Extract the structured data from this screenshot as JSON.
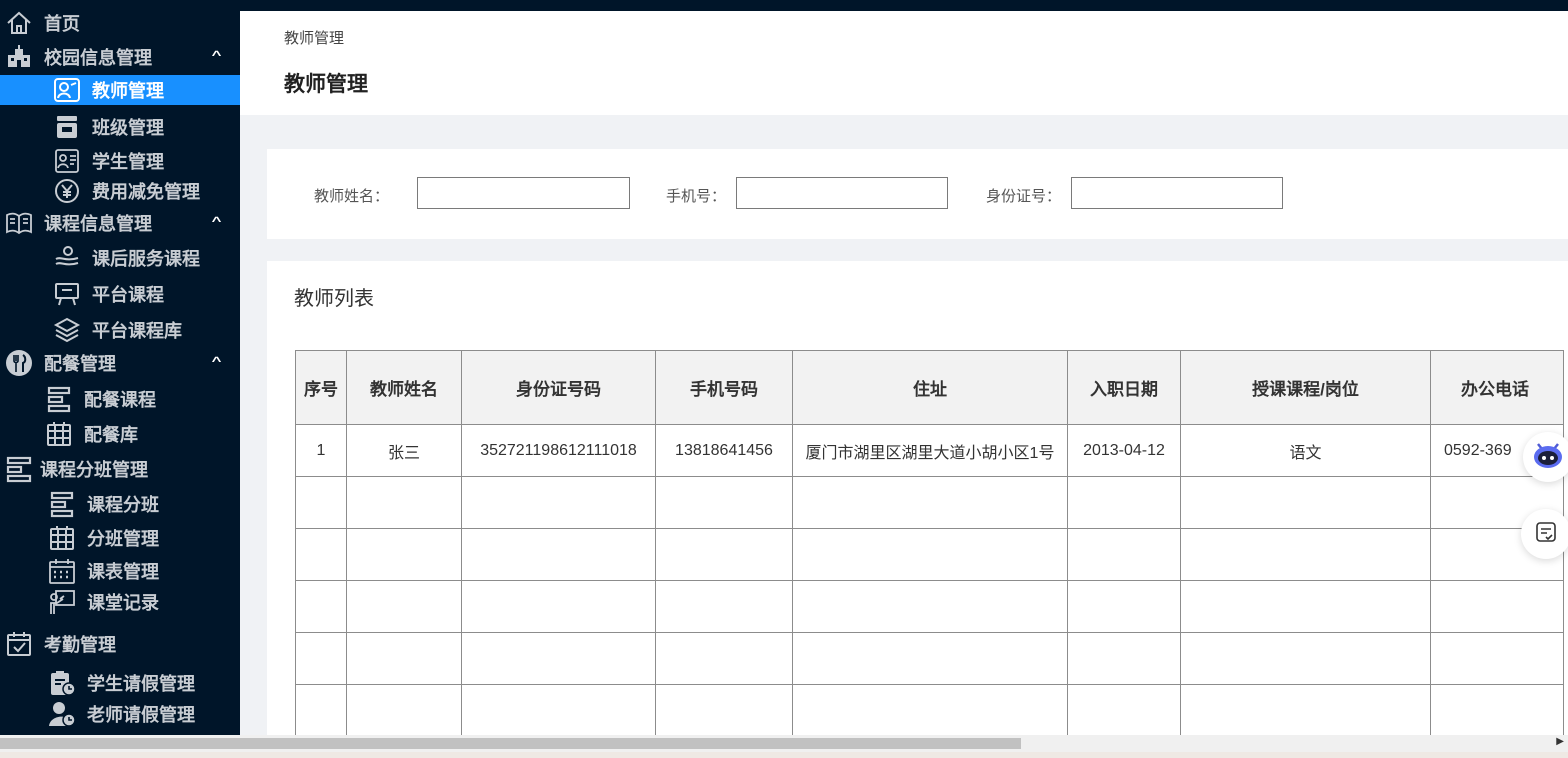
{
  "colors": {
    "sidebar_bg": "#001529",
    "active_bg": "#1890ff",
    "content_bg": "#f0f2f5"
  },
  "sidebar": {
    "home": {
      "label": "首页",
      "icon": "home-icon"
    },
    "groups": [
      {
        "label": "校园信息管理",
        "icon": "school-icon",
        "children": [
          {
            "label": "教师管理",
            "icon": "teacher-icon",
            "active": true
          },
          {
            "label": "班级管理",
            "icon": "class-icon"
          },
          {
            "label": "学生管理",
            "icon": "student-card-icon"
          },
          {
            "label": "费用减免管理",
            "icon": "yuan-icon"
          }
        ]
      },
      {
        "label": "课程信息管理",
        "icon": "book-icon",
        "children": [
          {
            "label": "课后服务课程",
            "icon": "service-icon"
          },
          {
            "label": "平台课程",
            "icon": "board-icon"
          },
          {
            "label": "平台课程库",
            "icon": "layers-icon"
          }
        ]
      },
      {
        "label": "配餐管理",
        "icon": "dining-icon",
        "children": [
          {
            "label": "配餐课程",
            "icon": "split-icon"
          },
          {
            "label": "配餐库",
            "icon": "grid-icon"
          }
        ]
      },
      {
        "label": "课程分班管理",
        "icon": "split-icon",
        "children": [
          {
            "label": "课程分班",
            "icon": "split-icon"
          },
          {
            "label": "分班管理",
            "icon": "calendar-icon"
          },
          {
            "label": "课表管理",
            "icon": "schedule-icon"
          },
          {
            "label": "课堂记录",
            "icon": "record-icon"
          }
        ]
      },
      {
        "label": "考勤管理",
        "icon": "attendance-icon",
        "children": [
          {
            "label": "学生请假管理",
            "icon": "leave-icon"
          },
          {
            "label": "老师请假管理",
            "icon": "teacher-leave-icon"
          }
        ]
      }
    ]
  },
  "header": {
    "breadcrumb": "教师管理",
    "title": "教师管理"
  },
  "search": {
    "name_label": "教师姓名：",
    "name_value": "",
    "phone_label": "手机号：",
    "phone_value": "",
    "id_label": "身份证号：",
    "id_value": ""
  },
  "list": {
    "title": "教师列表",
    "columns": [
      "序号",
      "教师姓名",
      "身份证号码",
      "手机号码",
      "住址",
      "入职日期",
      "授课课程/岗位",
      "办公电话"
    ],
    "rows": [
      [
        "1",
        "张三",
        "352721198612111018",
        "13818641456",
        "厦门市湖里区湖里大道小胡小区1号",
        "2013-04-12",
        "语文",
        "0592-369"
      ]
    ],
    "empty_rows": 5
  },
  "floating": {
    "assistant_icon": "robot-icon",
    "notes_icon": "notes-icon"
  }
}
